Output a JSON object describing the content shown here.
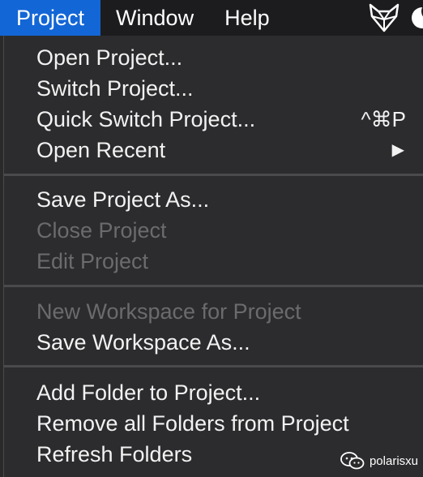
{
  "menubar": {
    "items": [
      {
        "label": "Project",
        "active": true
      },
      {
        "label": "Window"
      },
      {
        "label": "Help"
      }
    ],
    "right_icons": [
      "fox-icon",
      "moon-icon"
    ]
  },
  "menu": {
    "open_project": "Open Project...",
    "switch_project": "Switch Project...",
    "quick_switch_project": "Quick Switch Project...",
    "quick_switch_shortcut": "^⌘P",
    "open_recent": "Open Recent",
    "open_recent_arrow": "▶",
    "save_project_as": "Save Project As...",
    "close_project": "Close Project",
    "edit_project": "Edit Project",
    "new_workspace": "New Workspace for Project",
    "save_workspace_as": "Save Workspace As...",
    "add_folder": "Add Folder to Project...",
    "remove_all_folders": "Remove all Folders from Project",
    "refresh_folders": "Refresh Folders"
  },
  "watermark": {
    "text": "polarisxu",
    "icon": "wechat-icon"
  },
  "colors": {
    "menubar_bg": "#1c1c1e",
    "active_menu": "#1366d6",
    "dropdown_bg": "#2c2c2e",
    "enabled_text": "#f2f2f2",
    "disabled_text": "#6b6b6d"
  }
}
